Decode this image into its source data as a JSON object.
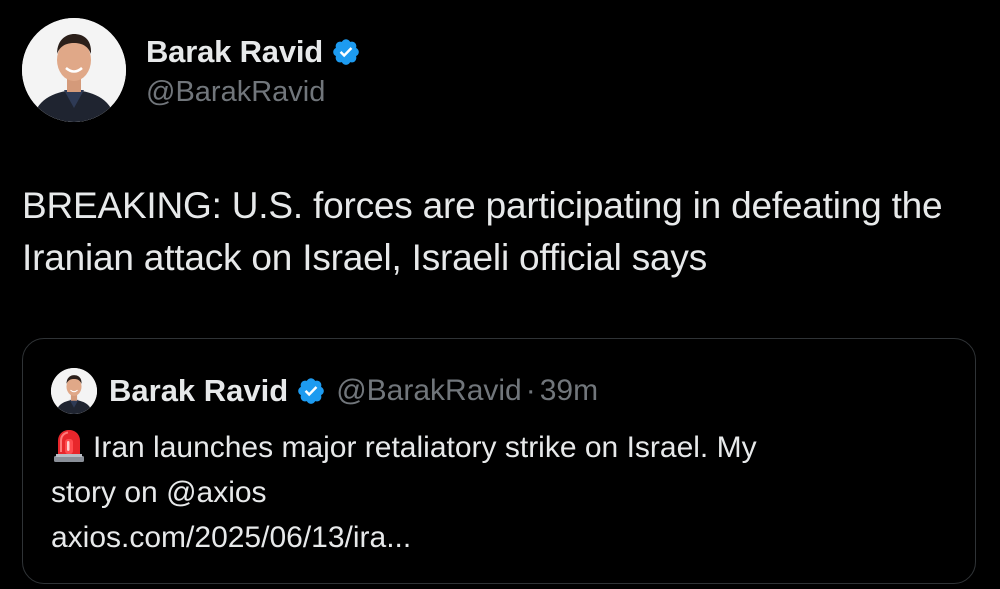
{
  "author": {
    "display_name": "Barak Ravid",
    "handle": "@BarakRavid",
    "avatar_icon": "profile-photo",
    "verified_icon": "verified-badge-icon",
    "verified_color": "#1d9bf0"
  },
  "tweet": {
    "text": "BREAKING: U.S. forces are participating in defeating the Iranian attack on Israel, Israeli official says"
  },
  "quote": {
    "display_name": "Barak Ravid",
    "handle": "@BarakRavid",
    "separator": "·",
    "time": "39m",
    "emoji_icon": "siren-icon",
    "text_line1": "Iran launches major retaliatory strike on Israel. My",
    "text_line2_prefix": "story on ",
    "mention": "@axios",
    "link": "axios.com/2025/06/13/ira..."
  },
  "colors": {
    "background": "#000000",
    "text": "#e7e9ea",
    "secondary": "#71767b",
    "border": "#2f3336",
    "verified": "#1d9bf0"
  }
}
